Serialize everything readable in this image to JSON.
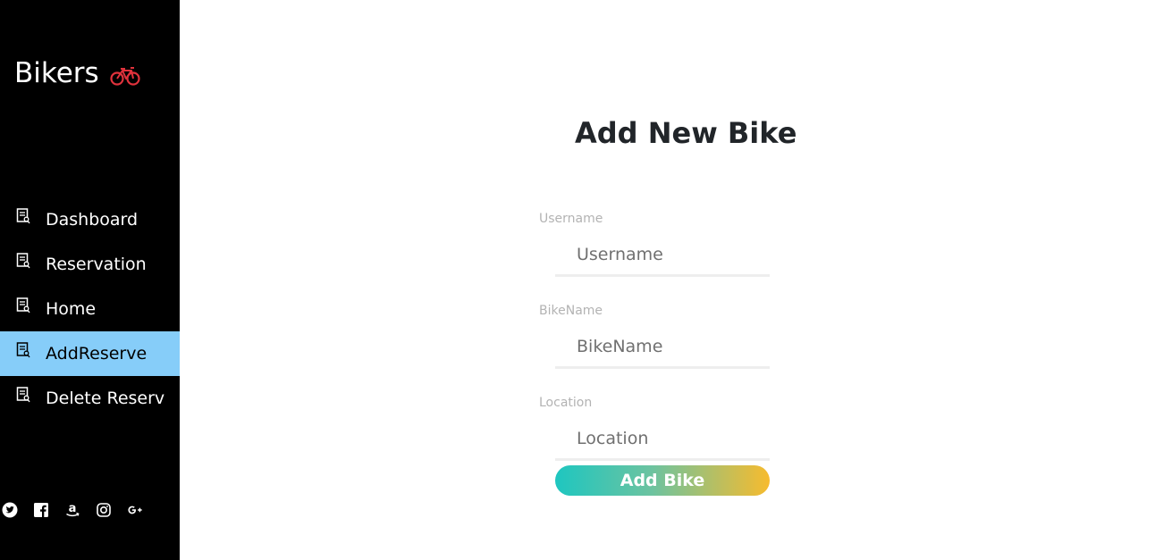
{
  "brand": {
    "title": "Bikers",
    "icon": "bicycle-icon",
    "icon_color": "#e0323c"
  },
  "sidebar": {
    "background": "#000000",
    "active_color": "#86cdf9",
    "items": [
      {
        "label": "Dashboard",
        "icon": "document-icon",
        "active": false
      },
      {
        "label": "Reservation",
        "icon": "document-icon",
        "active": false
      },
      {
        "label": "Home",
        "icon": "document-icon",
        "active": false
      },
      {
        "label": "AddReserve",
        "icon": "document-icon",
        "active": true
      },
      {
        "label": "Delete Reserv",
        "icon": "document-icon",
        "active": false
      }
    ],
    "social": [
      "twitter-icon",
      "facebook-icon",
      "amazon-icon",
      "instagram-icon",
      "google-plus-icon"
    ]
  },
  "form": {
    "title": "Add New Bike",
    "fields": [
      {
        "label": "Username",
        "placeholder": "Username",
        "value": ""
      },
      {
        "label": "BikeName",
        "placeholder": "BikeName",
        "value": ""
      },
      {
        "label": "Location",
        "placeholder": "Location",
        "value": ""
      }
    ],
    "submit_label": "Add Bike",
    "submit_gradient": [
      "#1ec6c0",
      "#f7bb2e"
    ]
  }
}
